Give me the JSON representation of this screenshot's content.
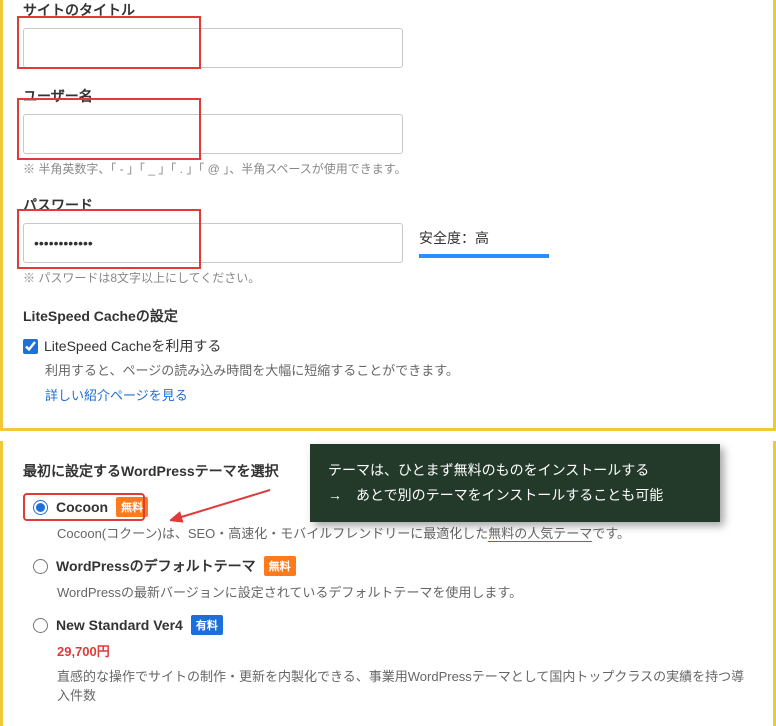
{
  "fields": {
    "siteTitle": {
      "label": "サイトのタイトル",
      "value": ""
    },
    "username": {
      "label": "ユーザー名",
      "value": "",
      "help": "※ 半角英数字、「 - 」「 _ 」「 . 」「 @ 」、半角スペースが使用できます。"
    },
    "password": {
      "label": "パスワード",
      "value": "••••••••••••",
      "help": "※ パスワードは8文字以上にしてください。"
    }
  },
  "safety": {
    "label": "安全度：高"
  },
  "litespeed": {
    "title": "LiteSpeed Cacheの設定",
    "checkboxLabel": "LiteSpeed Cacheを利用する",
    "desc": "利用すると、ページの読み込み時間を大幅に短縮することができます。",
    "link": "詳しい紹介ページを見る"
  },
  "themeSection": {
    "title": "最初に設定するWordPressテーマを選択",
    "themes": [
      {
        "name": "Cocoon",
        "badge": "無料",
        "badgeType": "free",
        "descPre": "Cocoon(コクーン)は、SEO・高速化・モバイルフレンドリーに最適化した",
        "descEm": "無料の人気テーマ",
        "descPost": "です。",
        "selected": true
      },
      {
        "name": "WordPressのデフォルトテーマ",
        "badge": "無料",
        "badgeType": "free",
        "desc": "WordPressの最新バージョンに設定されているデフォルトテーマを使用します。",
        "selected": false
      },
      {
        "name": "New Standard Ver4",
        "badge": "有料",
        "badgeType": "paid",
        "price": "29,700円",
        "desc": "直感的な操作でサイトの制作・更新を内製化できる、事業用WordPressテーマとして国内トップクラスの実績を持つ導入件数",
        "selected": false
      }
    ]
  },
  "tooltip": {
    "line1": "テーマは、ひとまず無料のものをインストールする",
    "line2": "→　あとで別のテーマをインストールすることも可能"
  }
}
